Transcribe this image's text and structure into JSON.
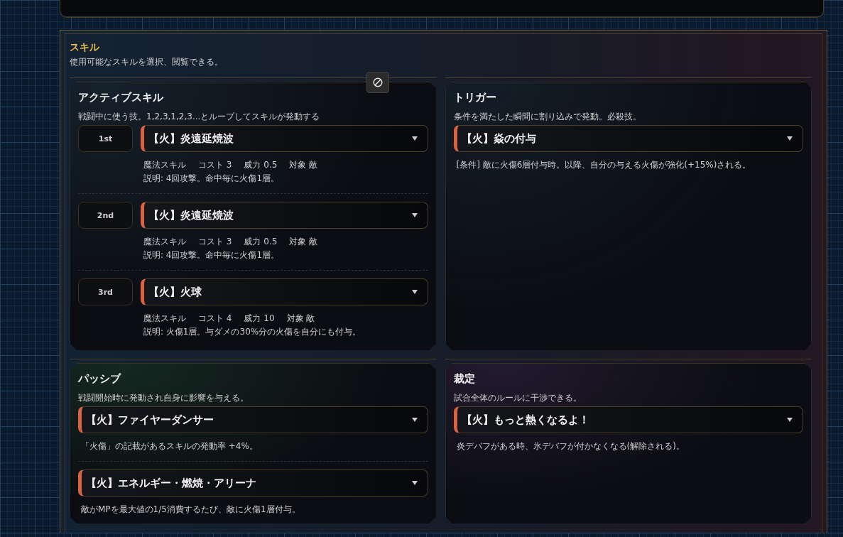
{
  "section": {
    "title": "スキル",
    "description": "使用可能なスキルを選択、閲覧できる。"
  },
  "panels": [
    {
      "title": "アクティブスキル",
      "description": "戦闘中に使う技。1,2,3,1,2,3...とループしてスキルが発動する",
      "slots": [
        {
          "label": "1st",
          "skill": "【火】炎遠延焼波",
          "stats": [
            "魔法スキル",
            "コスト 3",
            "威力 0.5",
            "対象 敵"
          ],
          "note": "説明: 4回攻撃。命中毎に火傷1層。"
        },
        {
          "label": "2nd",
          "skill": "【火】炎遠延焼波",
          "stats": [
            "魔法スキル",
            "コスト 3",
            "威力 0.5",
            "対象 敵"
          ],
          "note": "説明: 4回攻撃。命中毎に火傷1層。"
        },
        {
          "label": "3rd",
          "skill": "【火】火球",
          "stats": [
            "魔法スキル",
            "コスト 4",
            "威力 10",
            "対象 敵"
          ],
          "note": "説明: 火傷1層。与ダメの30%分の火傷を自分にも付与。"
        }
      ]
    },
    {
      "title": "トリガー",
      "description": "条件を満たした瞬間に割り込みで発動。必殺技。",
      "slots": [
        {
          "skill": "【火】焱の付与",
          "note": "[条件] 敵に火傷6層付与時。以降、自分の与える火傷が強化(+15%)される。"
        }
      ]
    },
    {
      "title": "パッシブ",
      "description": "戦闘開始時に発動され自身に影響を与える。",
      "slots": [
        {
          "skill": "【火】ファイヤーダンサー",
          "note": "「火傷」の記載があるスキルの発動率 +4%。"
        },
        {
          "skill": "【火】エネルギー・燃焼・アリーナ",
          "note": "敵がMPを最大値の1/5消費するたび、敵に火傷1層付与。"
        }
      ]
    },
    {
      "title": "裁定",
      "description": "試合全体のルールに干渉できる。",
      "slots": [
        {
          "skill": "【火】もっと熱くなるよ！",
          "note": "炎デバフがある時、氷デバフが付かなくなる(解除される)。"
        }
      ]
    }
  ]
}
